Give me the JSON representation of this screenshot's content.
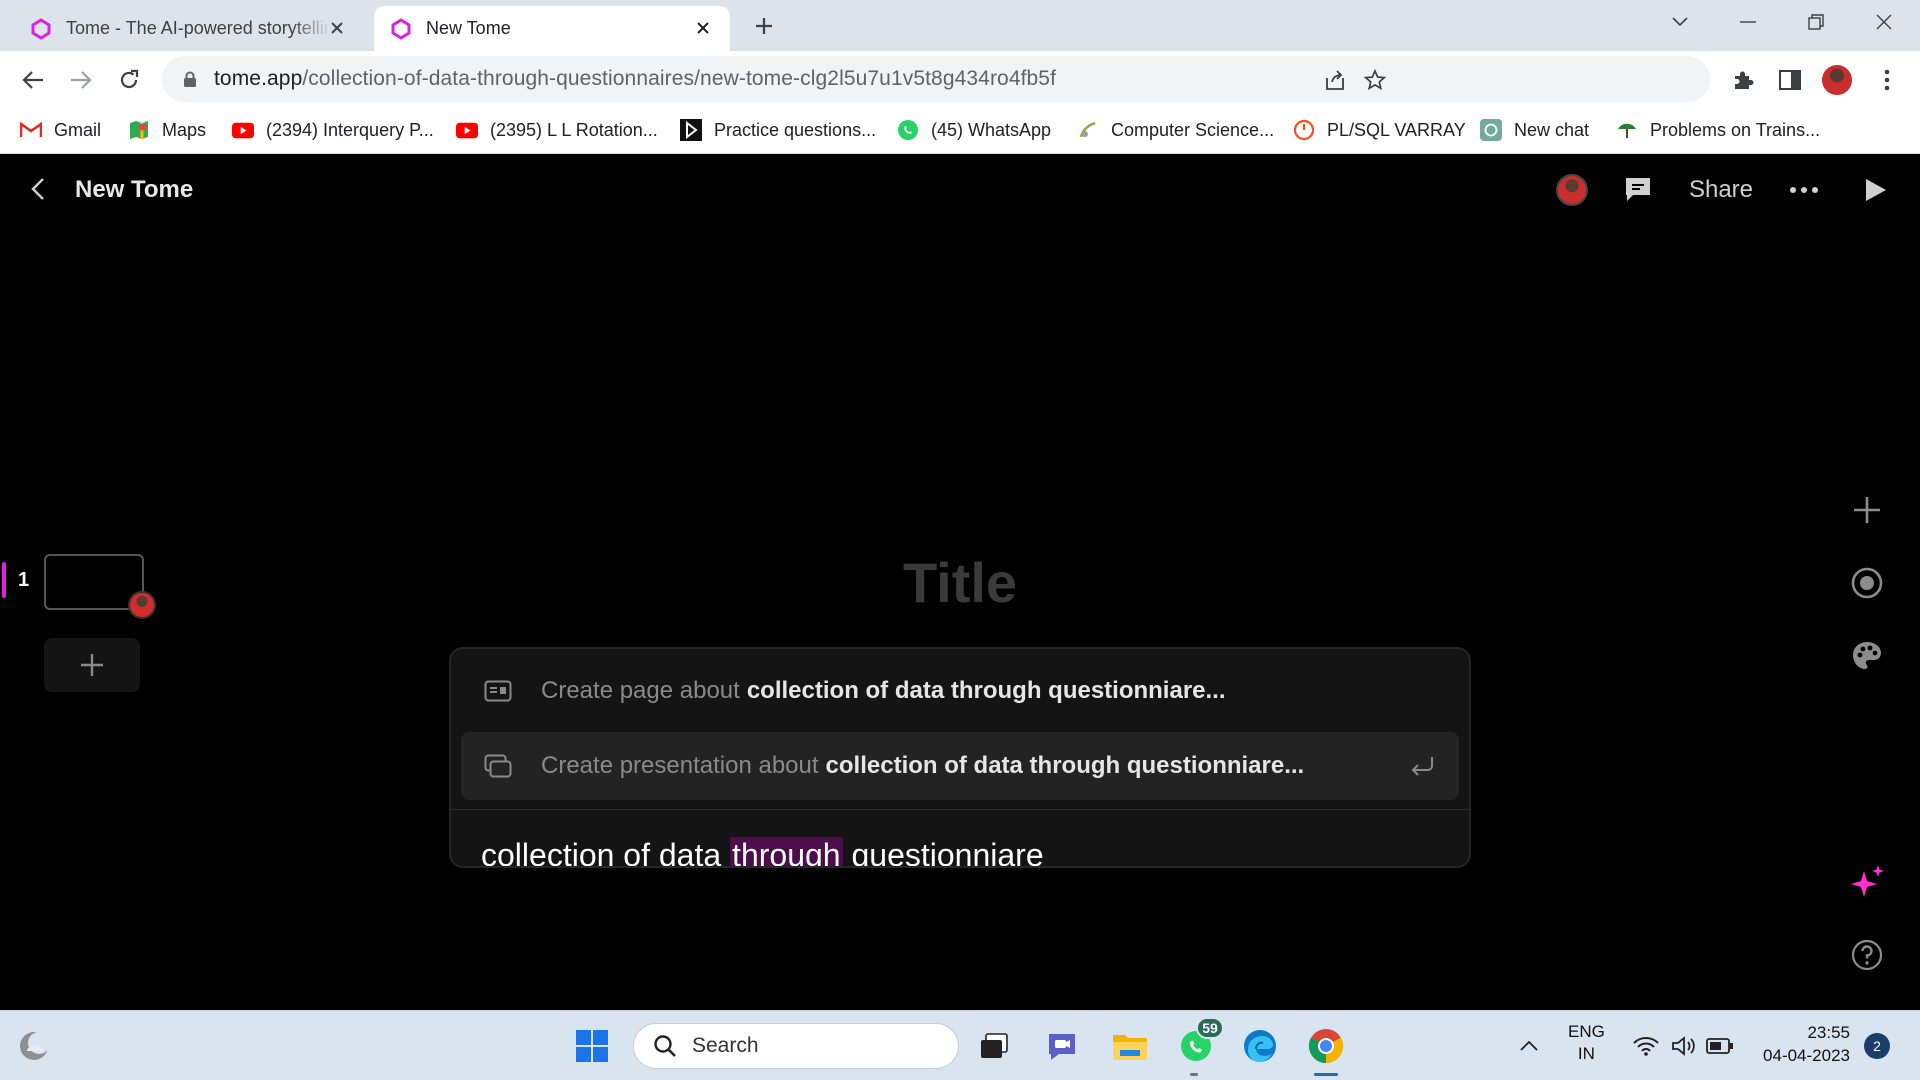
{
  "browser": {
    "tabs": [
      {
        "title": "Tome - The AI-powered storytelling",
        "active": false
      },
      {
        "title": "New Tome",
        "active": true
      }
    ],
    "url_host": "tome.app",
    "url_path": "/collection-of-data-through-questionnaires/new-tome-clg2l5u7u1v5t8g434ro4fb5f",
    "bookmarks": [
      {
        "label": "Gmail",
        "icon": "gmail-icon"
      },
      {
        "label": "Maps",
        "icon": "maps-icon"
      },
      {
        "label": "(2394) Interquery P...",
        "icon": "youtube-icon"
      },
      {
        "label": "(2395) L L Rotation...",
        "icon": "youtube-icon"
      },
      {
        "label": "Practice questions...",
        "icon": "practice-icon"
      },
      {
        "label": "(45) WhatsApp",
        "icon": "whatsapp-icon"
      },
      {
        "label": "Computer Science...",
        "icon": "site-icon"
      },
      {
        "label": "PL/SQL VARRAY",
        "icon": "site-icon"
      },
      {
        "label": "New chat",
        "icon": "chatgpt-icon"
      },
      {
        "label": "Problems on Trains...",
        "icon": "site-icon"
      }
    ]
  },
  "app": {
    "doc_title": "New Tome",
    "share_label": "Share",
    "slide_number": "1",
    "canvas_title_placeholder": "Title",
    "options": [
      {
        "prefix": "Create page about",
        "topic": "collection of data through questionniare..."
      },
      {
        "prefix": "Create presentation about",
        "topic": "collection of data through questionniare..."
      }
    ],
    "input": {
      "part1": "collection of data ",
      "highlight": "through",
      "space": " ",
      "misspelled": "questionniare"
    },
    "accent_color": "#e020e0"
  },
  "taskbar": {
    "search_label": "Search",
    "whatsapp_badge": "59",
    "lang_line1": "ENG",
    "lang_line2": "IN",
    "time": "23:55",
    "date": "04-04-2023",
    "notifications": "2"
  }
}
